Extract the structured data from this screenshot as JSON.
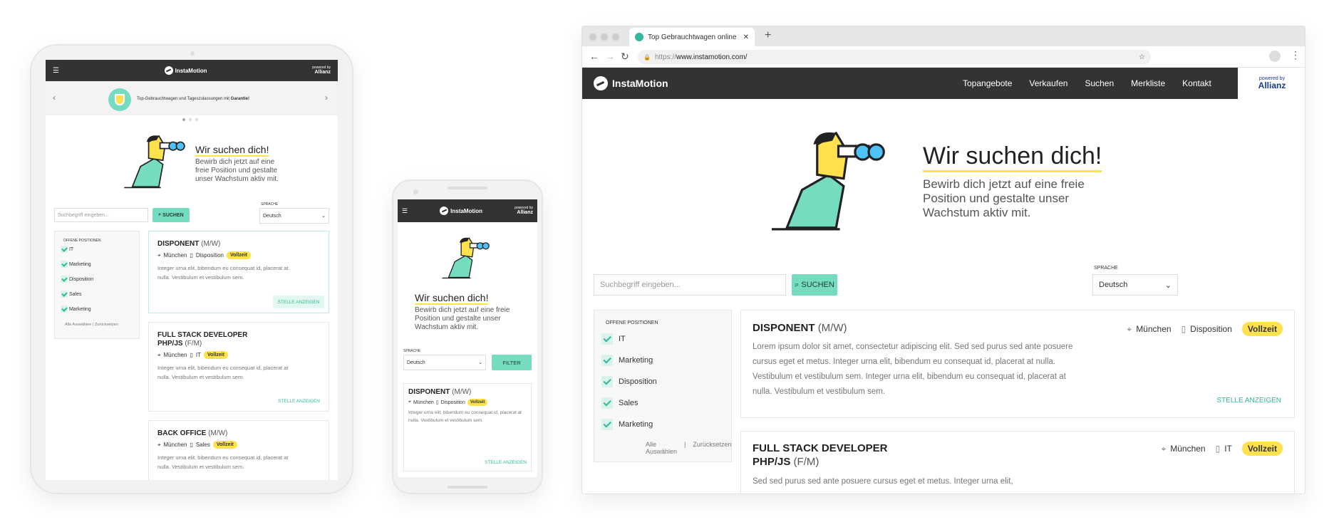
{
  "brand": {
    "name": "InstaMotion",
    "powered": "powered by",
    "partner": "Allianz"
  },
  "browser": {
    "tab_title": "Top Gebrauchtwagen online be",
    "url_scheme": "https://",
    "url_host": "www.instamotion.com/",
    "nav": [
      "Topangebote",
      "Verkaufen",
      "Suchen",
      "Merkliste",
      "Kontakt"
    ]
  },
  "hero": {
    "title": "Wir suchen dich!",
    "text": "Bewirb dich jetzt auf eine freie Position und gestalte unser Wachstum aktiv mit.",
    "tablet_text": "Bewirb dich jetzt auf eine freie Position und gestalte unser Wachstum aktiv mit."
  },
  "search": {
    "placeholder": "Suchbegriff eingeben...",
    "button": "SUCHEN",
    "filter_button": "FILTER"
  },
  "language": {
    "label": "SPRACHE",
    "value": "Deutsch"
  },
  "filters": {
    "heading": "OFFENE POSITIONEN",
    "items": [
      "IT",
      "Marketing",
      "Disposition",
      "Sales",
      "Marketing"
    ],
    "select_all": "Alle Auswählen",
    "separator": "|",
    "reset": "Zurücksetzen"
  },
  "banner": {
    "text_plain": "Top-Gebrauchtwagen und Tageszulassungen mit",
    "text_bold": "Garantie!"
  },
  "jobs": [
    {
      "title": "DISPONENT",
      "suffix": "(M/W)",
      "location": "München",
      "dept": "Disposition",
      "type": "Vollzeit",
      "desc_short": "Integer urna elit, bibendum eu consequat id, placerat at nulla. Vestibulum et vestibulum sem.",
      "desc_long": "Lorem ipsum dolor sit amet, consectetur adipiscing elit. Sed sed purus sed ante posuere cursus eget et metus. Integer urna elit, bibendum eu consequat id, placerat at nulla. Vestibulum et vestibulum sem. Integer urna elit, bibendum eu consequat id, placerat at nulla. Vestibulum et vestibulum sem.",
      "cta": "STELLE ANZEIGEN"
    },
    {
      "title_line1": "FULL STACK DEVELOPER",
      "title_line2": "PHP/JS",
      "suffix": "(F/M)",
      "location": "München",
      "dept": "IT",
      "type": "Vollzeit",
      "desc_short": "Integer urna elit, bibendum eu consequat id, placerat at nulla. Vestibulum et vestibulum sem.",
      "desc_long": "Sed sed purus sed ante posuere cursus eget et metus. Integer urna elit,",
      "cta": "STELLE ANZEIGEN"
    },
    {
      "title": "BACK OFFICE",
      "suffix": "(M/W)",
      "location": "München",
      "dept": "Sales",
      "type": "Vollzeit",
      "desc_short": "Integer urna elit, bibendum eu consequat id, placerat at nulla. Vestibulum et vestibulum sem."
    }
  ],
  "colors": {
    "accent": "#76dcc0",
    "dark": "#333333",
    "badge": "#ffe14d",
    "link": "#31b79a"
  }
}
